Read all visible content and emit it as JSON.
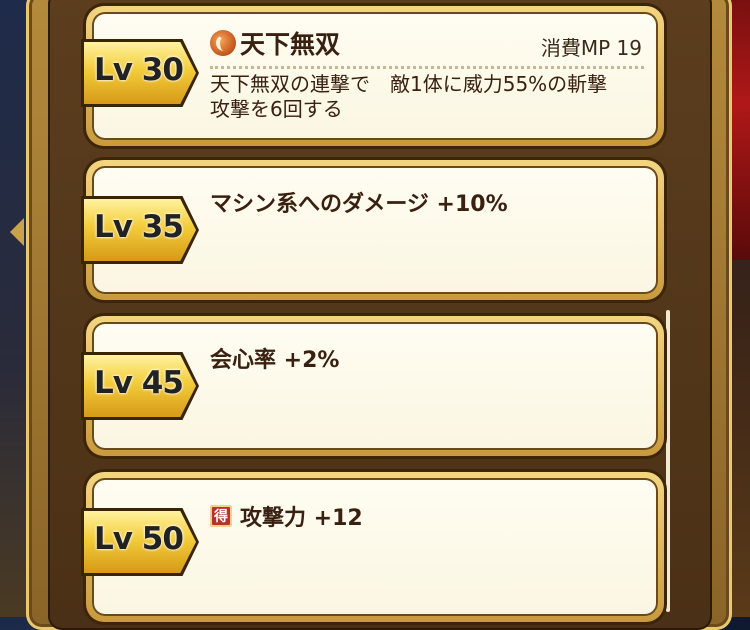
{
  "skills": [
    {
      "level_label": "Lv 30",
      "name": "天下無双",
      "mp": "消費MP 19",
      "description": "天下無双の連撃で　敵1体に威力55%の斬撃\n攻撃を6回する"
    },
    {
      "level_label": "Lv 35",
      "effect": "マシン系へのダメージ +10%"
    },
    {
      "level_label": "Lv 45",
      "effect": "会心率 +2%"
    },
    {
      "level_label": "Lv 50",
      "badge": "得",
      "effect": "攻撃力 +12"
    }
  ],
  "colors": {
    "frame_gold": "#c99a3c",
    "card_bg": "#fbf6e2",
    "text_brown": "#3a2010",
    "badge_gold": "#f3cc3a"
  },
  "icons": [
    "skill-slash-icon",
    "toku-badge-icon",
    "left-arrow-icon"
  ]
}
